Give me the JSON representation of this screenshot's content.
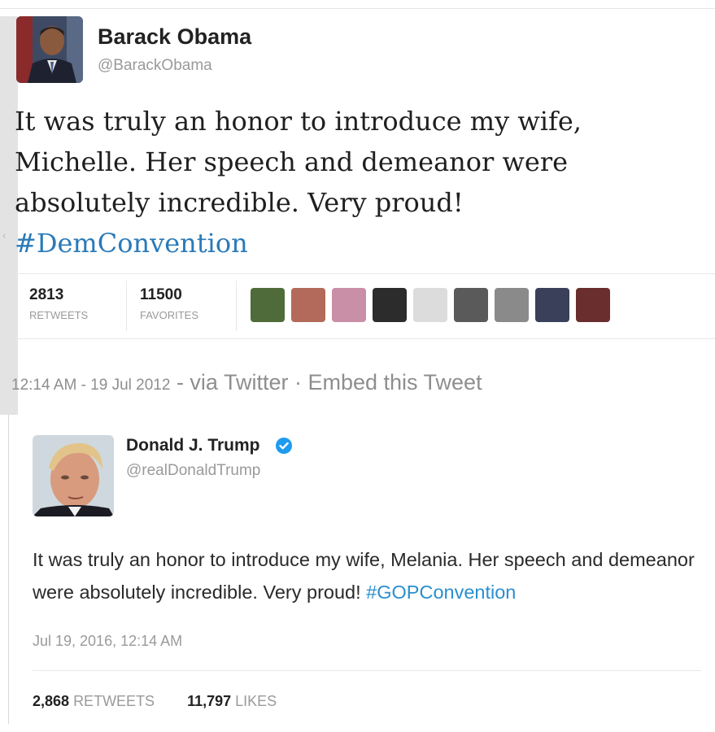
{
  "obama_tweet": {
    "name": "Barack Obama",
    "handle": "@BarackObama",
    "text": "It was truly an honor to introduce my wife, Michelle. Her speech and demeanor were absolutely incredible. Very proud!",
    "hashtag": "#DemConvention",
    "retweets_count": "2813",
    "retweets_label": "RETWEETS",
    "favorites_count": "11500",
    "favorites_label": "FAVORITES",
    "timestamp": "12:14 AM - 19 Jul 2012",
    "via": "- via Twitter · Embed this Tweet",
    "favoriter_avatars": [
      "favoriter-1",
      "favoriter-2",
      "favoriter-3",
      "favoriter-4",
      "favoriter-5",
      "favoriter-6",
      "favoriter-7",
      "favoriter-8",
      "favoriter-9"
    ]
  },
  "trump_tweet": {
    "name": "Donald J. Trump",
    "verified_icon": "verified-badge-icon",
    "handle": "@realDonaldTrump",
    "text": "It was truly an honor to introduce my wife, Melania. Her speech and demeanor were absolutely incredible. Very proud! ",
    "hashtag": "#GOPConvention",
    "date": "Jul 19, 2016, 12:14 AM",
    "retweets_count": "2,868",
    "retweets_label": "RETWEETS",
    "likes_count": "11,797",
    "likes_label": "LIKES"
  },
  "colors": {
    "hashtag_blue": "#2a7ab8",
    "verified_blue": "#1d9bf0",
    "muted_gray": "#9a9a9a"
  }
}
